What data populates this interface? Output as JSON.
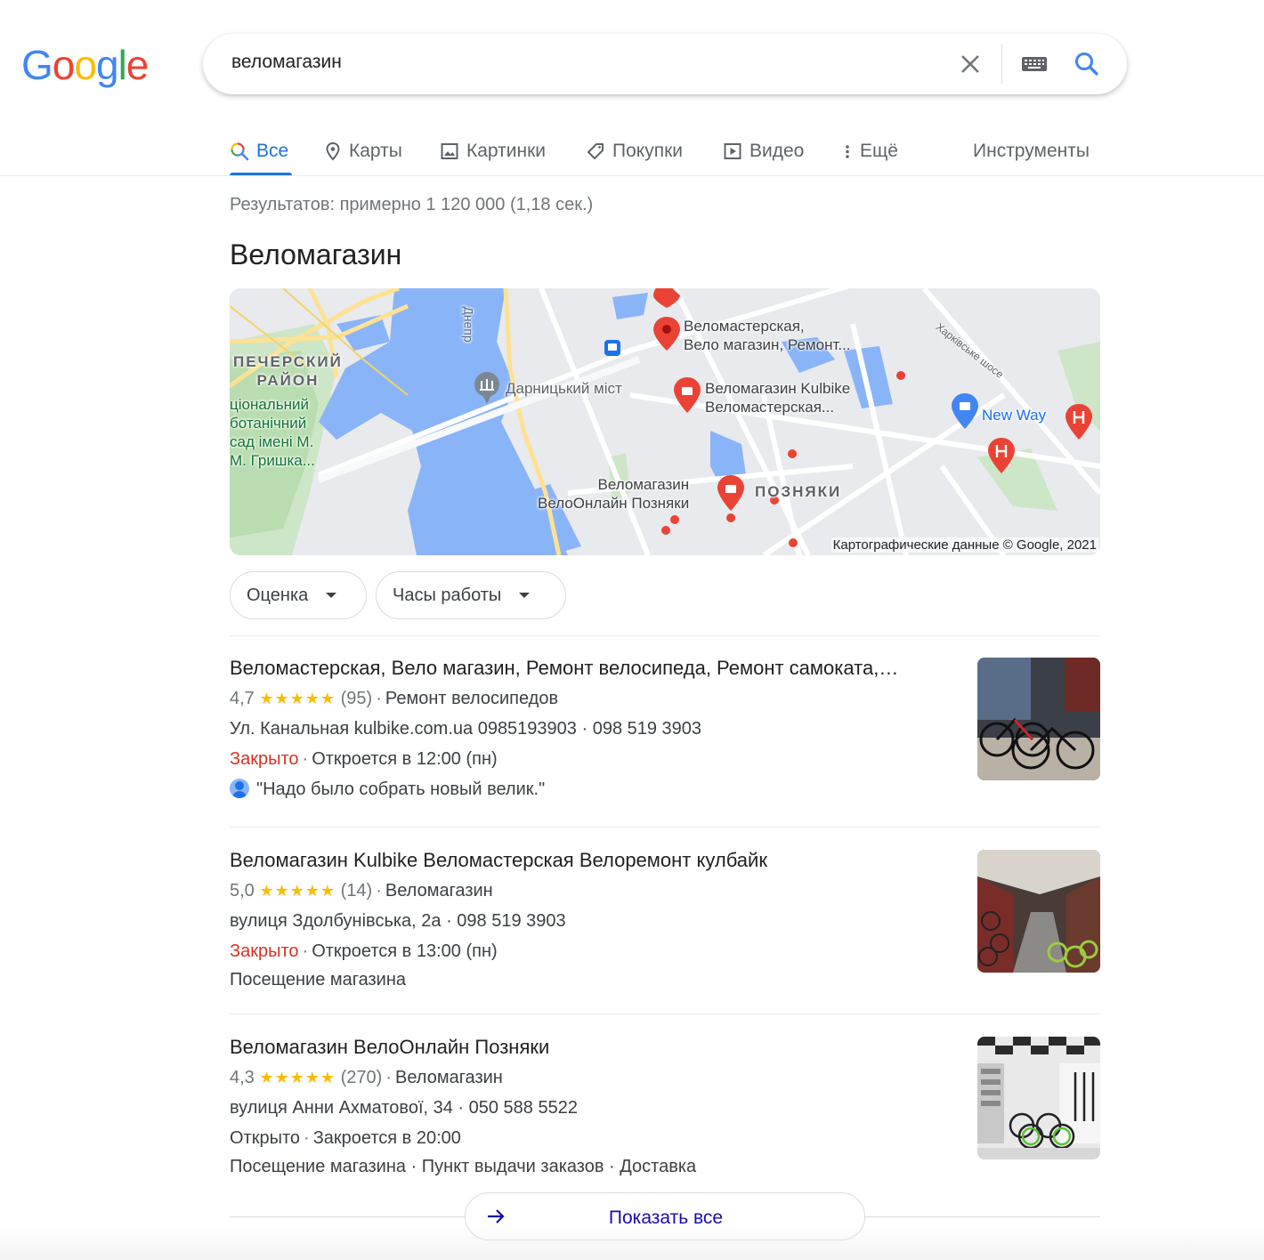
{
  "logo": {
    "text": "Google",
    "letters": [
      "G",
      "o",
      "o",
      "g",
      "l",
      "e"
    ]
  },
  "search": {
    "query": "веломагазин",
    "clear_icon": "close-icon",
    "keyboard_icon": "keyboard-icon",
    "search_icon": "search-icon"
  },
  "tabs": [
    {
      "label": "Все",
      "icon": "search-multicolor-icon",
      "active": true
    },
    {
      "label": "Карты",
      "icon": "map-pin-icon"
    },
    {
      "label": "Картинки",
      "icon": "image-icon"
    },
    {
      "label": "Покупки",
      "icon": "tag-icon"
    },
    {
      "label": "Видео",
      "icon": "play-icon"
    },
    {
      "label": "Ещё",
      "icon": "more-vert-icon"
    }
  ],
  "tools_label": "Инструменты",
  "stats": "Результатов: примерно 1 120 000 (1,18 сек.)",
  "local_heading": "Веломагазин",
  "map": {
    "labels": {
      "district1": "ПЕЧЕРСКИЙ\nРАЙОН",
      "garden": "ціональний\nботанічний\nсад імені М.\nМ. Гришка...",
      "river": "Днепр",
      "bridge": "Дарницький міст",
      "shop1": "Веломастерская,\nВело магазин, Ремонт...",
      "shop2": "Веломагазин Kulbike\nВеломастерская...",
      "shop3": "Веломагазин\nВелоОнлайн Позняки",
      "district2": "ПОЗНЯКИ",
      "highway": "Харківське шосе",
      "newway": "New Way"
    },
    "attribution": "Картографические данные © Google, 2021"
  },
  "filters": [
    {
      "label": "Оценка"
    },
    {
      "label": "Часы работы"
    }
  ],
  "listings": [
    {
      "title": "Веломастерская, Вело магазин, Ремонт велосипеда, Ремонт самоката,…",
      "rating": "4,7",
      "stars": "★★★★★",
      "reviews": "(95)",
      "category": "Ремонт велосипедов",
      "address": "Ул. Канальная kulbike.com.ua 0985193903 · 098 519 3903",
      "status": "Закрыто",
      "status_closed": true,
      "hours": "Откроется в 12:00 (пн)",
      "extra": "\"Надо было собрать новый велик.\""
    },
    {
      "title": "Веломагазин Kulbike Веломастерская Велоремонт кулбайк",
      "rating": "5,0",
      "stars": "★★★★★",
      "reviews": "(14)",
      "category": "Веломагазин",
      "address": "вулиця Здолбунівська, 2а · 098 519 3903",
      "status": "Закрыто",
      "status_closed": true,
      "hours": "Откроется в 13:00 (пн)",
      "extra": "Посещение магазина"
    },
    {
      "title": "Веломагазин ВелоОнлайн Позняки",
      "rating": "4,3",
      "stars": "★★★★★",
      "reviews": "(270)",
      "category": "Веломагазин",
      "address": "вулиця Анни Ахматової, 34 · 050 588 5522",
      "status": "Открыто",
      "status_closed": false,
      "hours": "Закроется в 20:00",
      "extra": "Посещение магазина · Пункт выдачи заказов · Доставка"
    }
  ],
  "show_all": "Показать все",
  "colors": {
    "accent": "#1a73e8",
    "closed": "#d93025",
    "stars": "#fbbc04",
    "link": "#1a0dab"
  }
}
